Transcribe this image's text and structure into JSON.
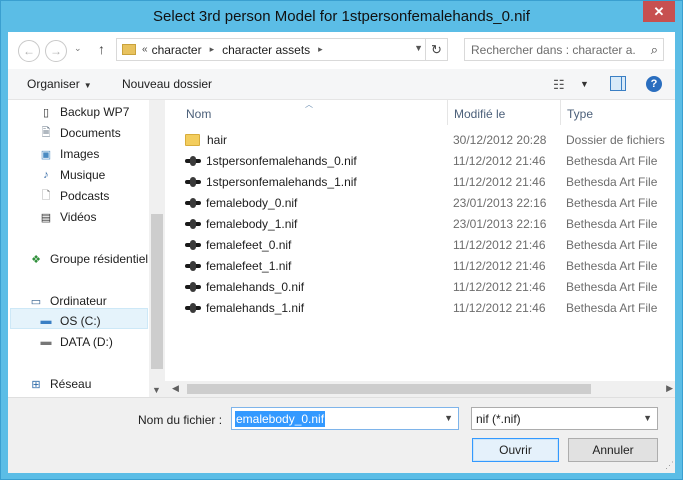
{
  "window": {
    "title": "Select 3rd person Model for 1stpersonfemalehands_0.nif",
    "close_glyph": "✕"
  },
  "nav": {
    "back_glyph": "←",
    "forward_glyph": "→",
    "history_glyph": "⌄",
    "up_glyph": "↑",
    "breadcrumb_overflow": "«",
    "breadcrumbs": [
      "character",
      "character assets"
    ],
    "refresh_glyph": "↻",
    "search_placeholder": "Rechercher dans : character a..."
  },
  "toolbar": {
    "organize_label": "Organiser",
    "new_folder_label": "Nouveau dossier",
    "help_glyph": "?"
  },
  "sidebar": {
    "items": [
      {
        "label": "Backup WP7",
        "icon": "phone-icon"
      },
      {
        "label": "Documents",
        "icon": "documents-icon"
      },
      {
        "label": "Images",
        "icon": "images-icon"
      },
      {
        "label": "Musique",
        "icon": "music-icon"
      },
      {
        "label": "Podcasts",
        "icon": "podcasts-icon"
      },
      {
        "label": "Vidéos",
        "icon": "videos-icon"
      },
      {
        "label": "Groupe résidentiel",
        "icon": "homegroup-icon"
      },
      {
        "label": "Ordinateur",
        "icon": "computer-icon"
      },
      {
        "label": "OS (C:)",
        "icon": "drive-c-icon"
      },
      {
        "label": "DATA (D:)",
        "icon": "drive-d-icon"
      },
      {
        "label": "Réseau",
        "icon": "network-icon"
      }
    ],
    "selected": "OS (C:)"
  },
  "file_list": {
    "columns": [
      "Nom",
      "Modifié le",
      "Type"
    ],
    "sort_column": "Nom",
    "rows": [
      {
        "name": "hair",
        "date": "30/12/2012 20:28",
        "type": "Dossier de fichiers",
        "icon": "folder-icon"
      },
      {
        "name": "1stpersonfemalehands_0.nif",
        "date": "11/12/2012 21:46",
        "type": "Bethesda Art File",
        "icon": "nif-file-icon"
      },
      {
        "name": "1stpersonfemalehands_1.nif",
        "date": "11/12/2012 21:46",
        "type": "Bethesda Art File",
        "icon": "nif-file-icon"
      },
      {
        "name": "femalebody_0.nif",
        "date": "23/01/2013 22:16",
        "type": "Bethesda Art File",
        "icon": "nif-file-icon"
      },
      {
        "name": "femalebody_1.nif",
        "date": "23/01/2013 22:16",
        "type": "Bethesda Art File",
        "icon": "nif-file-icon"
      },
      {
        "name": "femalefeet_0.nif",
        "date": "11/12/2012 21:46",
        "type": "Bethesda Art File",
        "icon": "nif-file-icon"
      },
      {
        "name": "femalefeet_1.nif",
        "date": "11/12/2012 21:46",
        "type": "Bethesda Art File",
        "icon": "nif-file-icon"
      },
      {
        "name": "femalehands_0.nif",
        "date": "11/12/2012 21:46",
        "type": "Bethesda Art File",
        "icon": "nif-file-icon"
      },
      {
        "name": "femalehands_1.nif",
        "date": "11/12/2012 21:46",
        "type": "Bethesda Art File",
        "icon": "nif-file-icon"
      }
    ]
  },
  "footer": {
    "filename_label": "Nom du fichier :",
    "filename_value": "emalebody_0.nif",
    "filetype_value": "nif (*.nif)",
    "open_label": "Ouvrir",
    "cancel_label": "Annuler"
  },
  "colors": {
    "window_frame": "#5bbde6",
    "close_button": "#c75050",
    "selection": "#3399ff",
    "header_text": "#4c607a"
  }
}
